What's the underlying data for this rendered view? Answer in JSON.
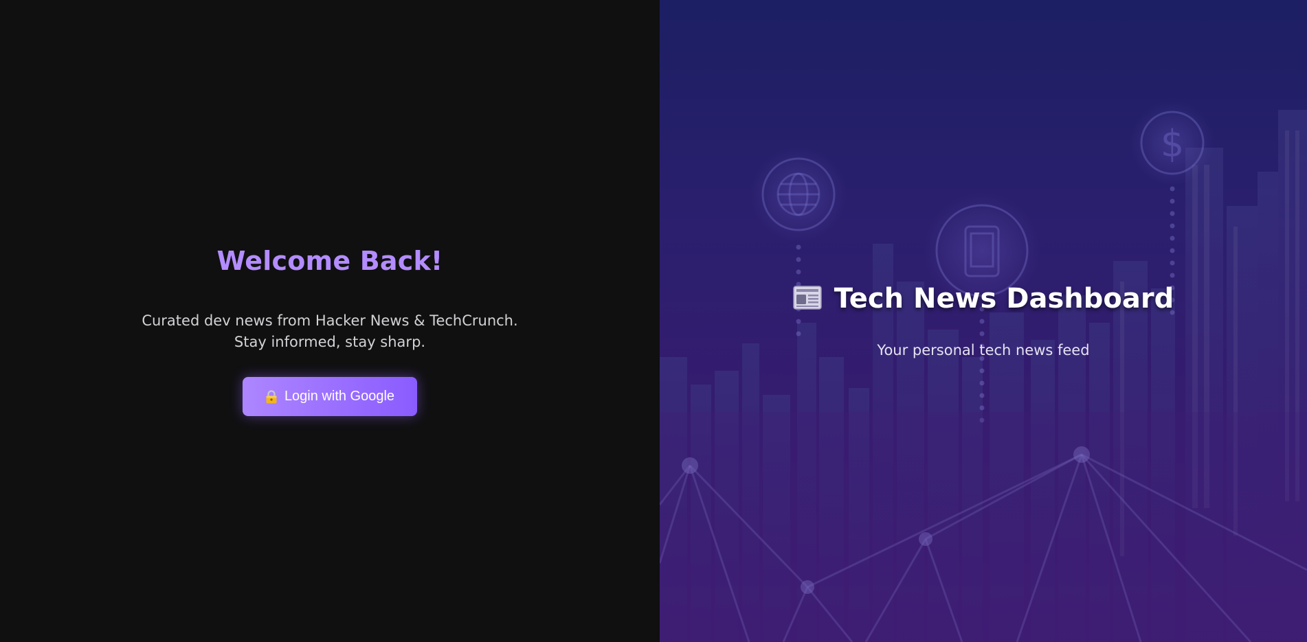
{
  "login": {
    "heading": "Welcome Back!",
    "subtitle_line1": "Curated dev news from Hacker News & TechCrunch.",
    "subtitle_line2": "Stay informed, stay sharp.",
    "button_label": "Login with Google",
    "button_icon": "lock-icon"
  },
  "hero": {
    "title": "Tech News Dashboard",
    "title_icon": "newspaper-icon",
    "subtitle": "Your personal tech news feed"
  },
  "colors": {
    "left_bg": "#101011",
    "accent": "#b38cff",
    "button_start": "#ad86ff",
    "button_end": "#8a5cff",
    "right_bg_top": "#1c1f63",
    "right_bg_bottom": "#3f1d73"
  }
}
